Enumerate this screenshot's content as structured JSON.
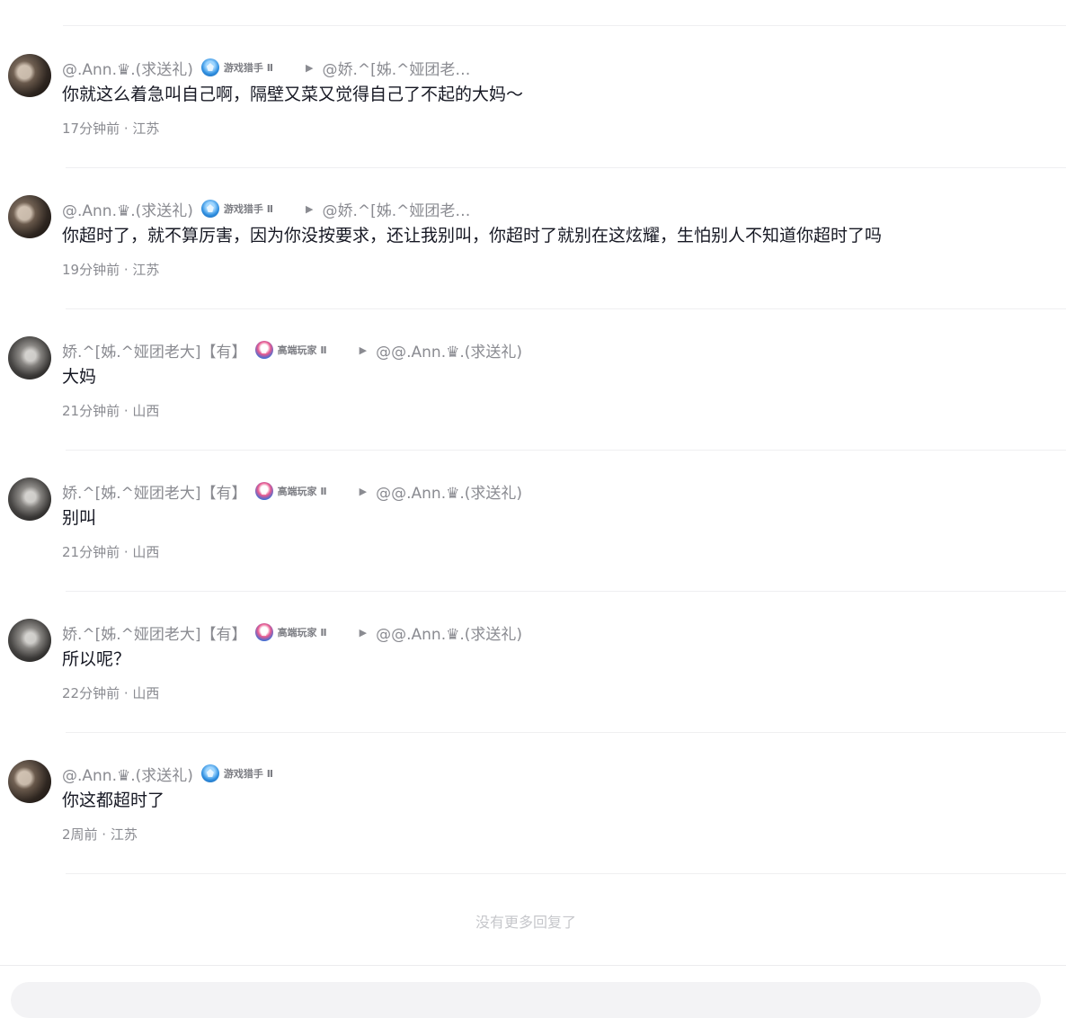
{
  "comments": [
    {
      "user": "@.Ann.♛.(求送礼)",
      "badge": "游戏猎手 Ⅱ",
      "badge_icon": "game-hunter-badge-icon",
      "reply_to": "@娇.^[姊.^娅团老…",
      "text": "你就这么着急叫自己啊，隔壁又菜又觉得自己了不起的大妈～",
      "time": "17分钟前 · 江苏"
    },
    {
      "user": "@.Ann.♛.(求送礼)",
      "badge": "游戏猎手 Ⅱ",
      "badge_icon": "game-hunter-badge-icon",
      "reply_to": "@娇.^[姊.^娅团老…",
      "text": "你超时了，就不算厉害，因为你没按要求，还让我别叫，你超时了就别在这炫耀，生怕别人不知道你超时了吗",
      "time": "19分钟前 · 江苏"
    },
    {
      "user": "娇.^[姊.^娅团老大]【有】",
      "badge": "高端玩家 Ⅱ",
      "badge_icon": "pro-player-badge-icon",
      "reply_to": "@@.Ann.♛.(求送礼)",
      "text": "大妈",
      "time": "21分钟前 · 山西"
    },
    {
      "user": "娇.^[姊.^娅团老大]【有】",
      "badge": "高端玩家 Ⅱ",
      "badge_icon": "pro-player-badge-icon",
      "reply_to": "@@.Ann.♛.(求送礼)",
      "text": "别叫",
      "time": "21分钟前 · 山西"
    },
    {
      "user": "娇.^[姊.^娅团老大]【有】",
      "badge": "高端玩家 Ⅱ",
      "badge_icon": "pro-player-badge-icon",
      "reply_to": "@@.Ann.♛.(求送礼)",
      "text": "所以呢？",
      "time": "22分钟前 · 山西"
    },
    {
      "user": "@.Ann.♛.(求送礼)",
      "badge": "游戏猎手 Ⅱ",
      "badge_icon": "game-hunter-badge-icon",
      "reply_to": "",
      "text": "你这都超时了",
      "time": "2周前 · 江苏"
    }
  ],
  "reply_arrow": "▶",
  "footer": {
    "no_more": "没有更多回复了"
  },
  "colors": {
    "username": "#8a8b91",
    "text": "#161823",
    "divider": "#efeff1",
    "no_more": "#c6c7cb"
  }
}
